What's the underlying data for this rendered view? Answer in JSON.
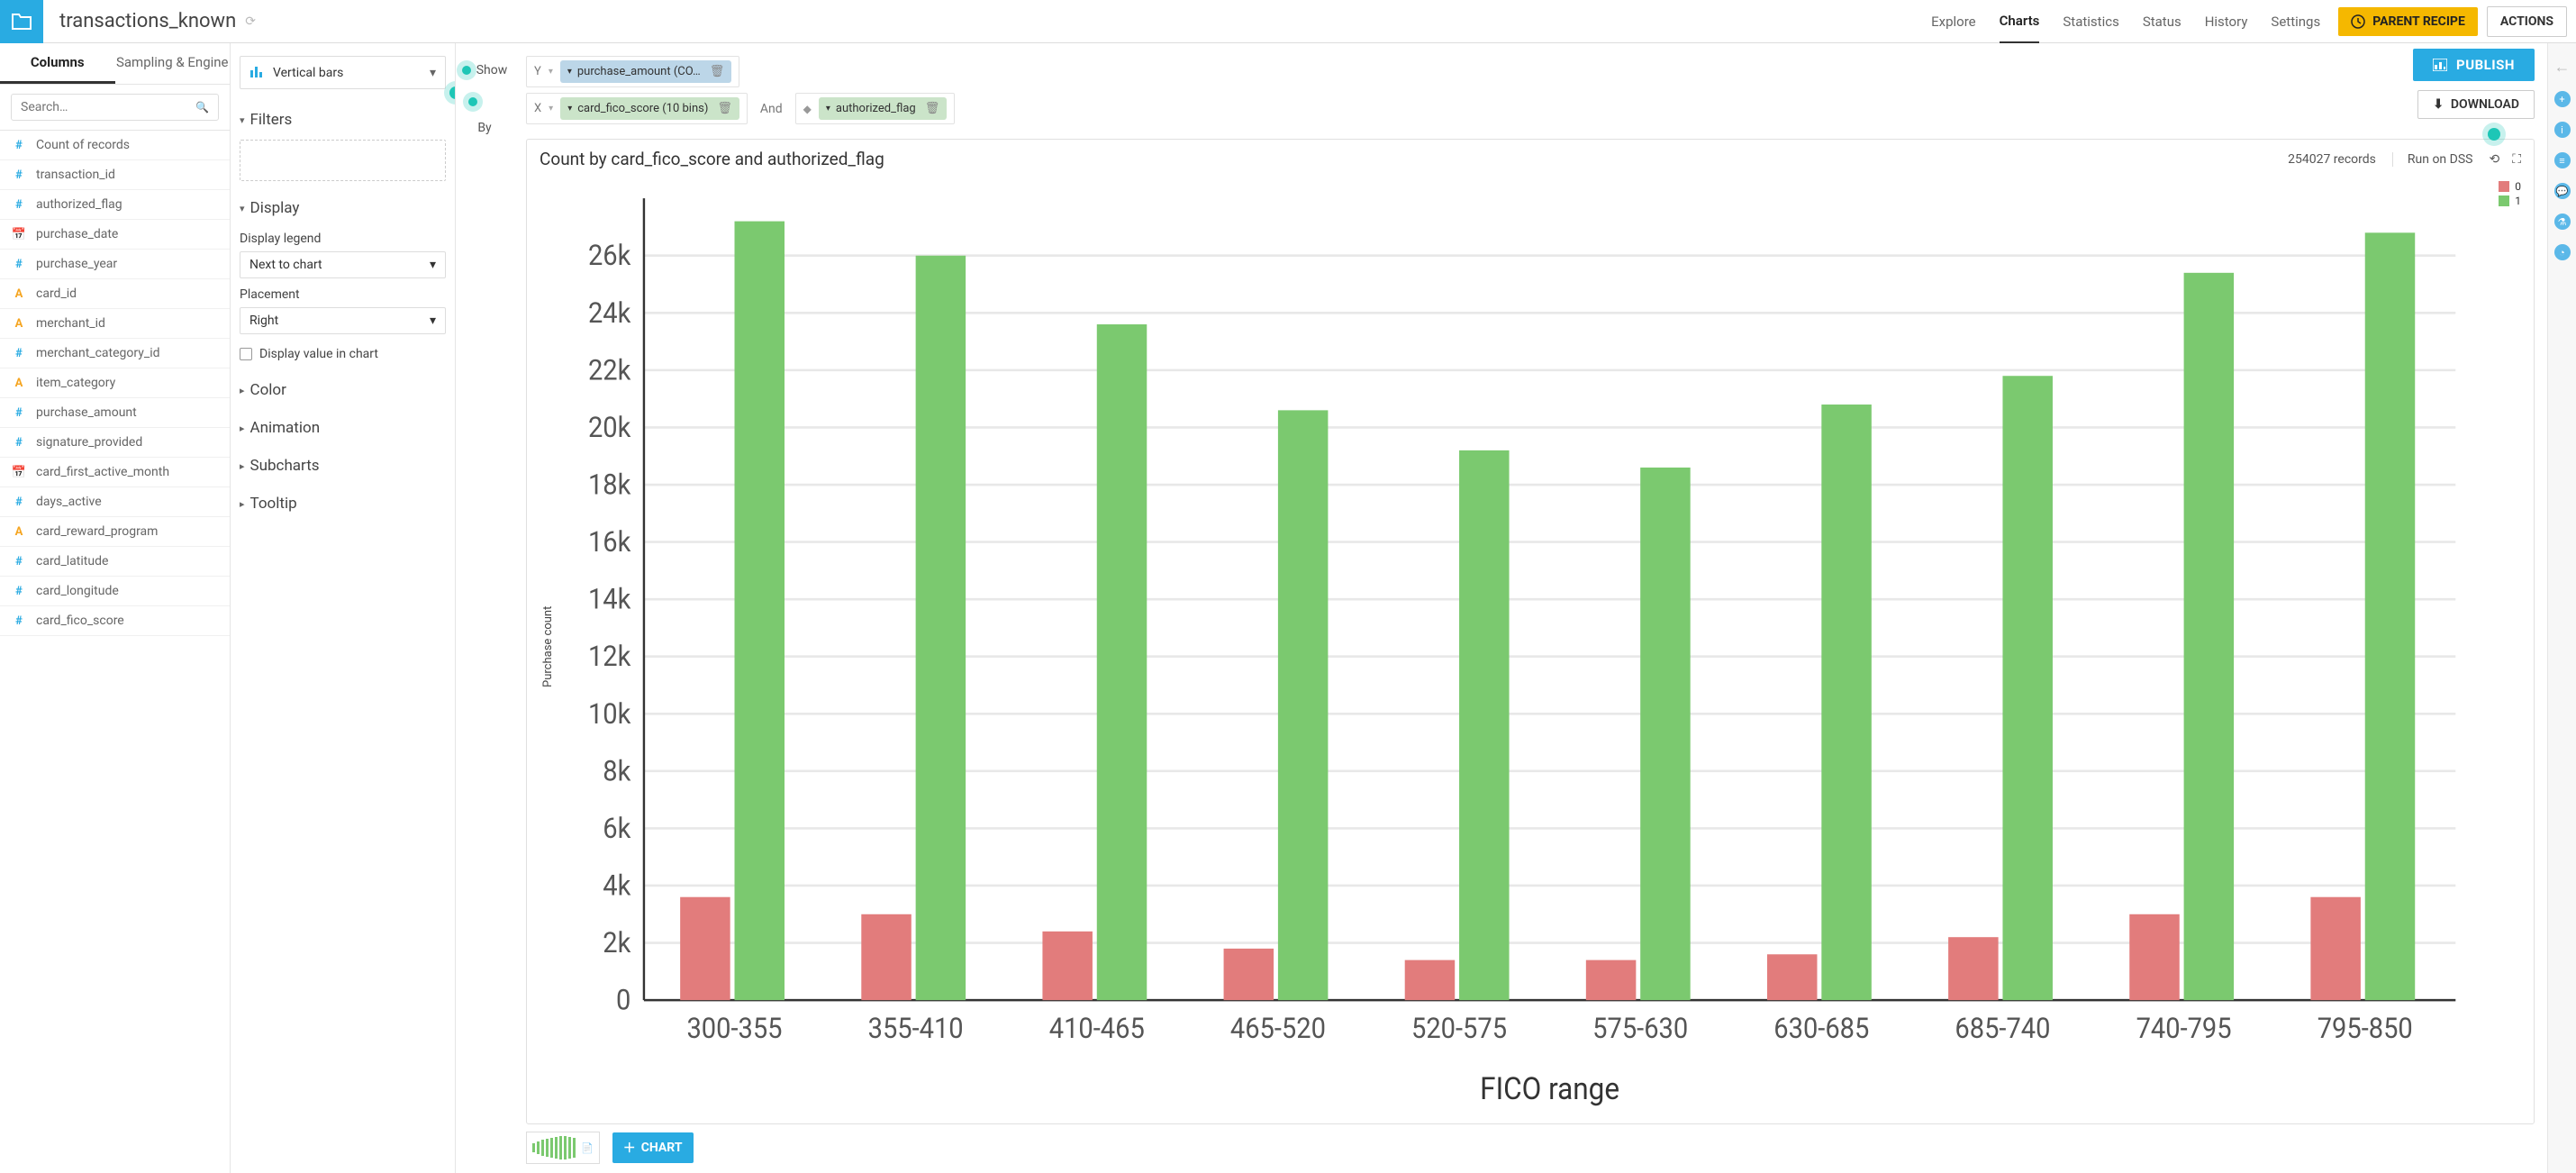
{
  "header": {
    "dataset_name": "transactions_known",
    "nav": [
      "Explore",
      "Charts",
      "Statistics",
      "Status",
      "History",
      "Settings"
    ],
    "nav_active": "Charts",
    "parent_recipe": "PARENT RECIPE",
    "actions": "ACTIONS"
  },
  "columns_panel": {
    "tabs": {
      "columns": "Columns",
      "sampling": "Sampling & Engine"
    },
    "search_placeholder": "Search…",
    "items": [
      {
        "type": "num",
        "label": "Count of records"
      },
      {
        "type": "num",
        "label": "transaction_id"
      },
      {
        "type": "num",
        "label": "authorized_flag"
      },
      {
        "type": "date",
        "label": "purchase_date"
      },
      {
        "type": "num",
        "label": "purchase_year"
      },
      {
        "type": "text",
        "label": "card_id"
      },
      {
        "type": "text",
        "label": "merchant_id"
      },
      {
        "type": "num",
        "label": "merchant_category_id"
      },
      {
        "type": "text",
        "label": "item_category"
      },
      {
        "type": "num",
        "label": "purchase_amount"
      },
      {
        "type": "num",
        "label": "signature_provided"
      },
      {
        "type": "date",
        "label": "card_first_active_month"
      },
      {
        "type": "num",
        "label": "days_active"
      },
      {
        "type": "text",
        "label": "card_reward_program"
      },
      {
        "type": "num",
        "label": "card_latitude"
      },
      {
        "type": "num",
        "label": "card_longitude"
      },
      {
        "type": "num",
        "label": "card_fico_score"
      }
    ]
  },
  "config": {
    "chart_type": "Vertical bars",
    "sections": {
      "filters": "Filters",
      "display": "Display",
      "color": "Color",
      "animation": "Animation",
      "subcharts": "Subcharts",
      "tooltip": "Tooltip"
    },
    "display_legend_label": "Display legend",
    "display_legend_value": "Next to chart",
    "placement_label": "Placement",
    "placement_value": "Right",
    "display_value_checkbox": "Display value in chart"
  },
  "showby": {
    "show": "Show",
    "by": "By"
  },
  "axes": {
    "y_label": "Y",
    "y_chip": "purchase_amount (CO…",
    "x_label": "X",
    "x_chip": "card_fico_score (10 bins)",
    "and_label": "And",
    "and_chip": "authorized_flag"
  },
  "buttons": {
    "publish": "PUBLISH",
    "download": "DOWNLOAD",
    "chart_add": "CHART"
  },
  "chart_meta": {
    "title": "Count by card_fico_score and authorized_flag",
    "records": "254027 records",
    "run_on": "Run on DSS"
  },
  "chart_data": {
    "type": "bar",
    "title": "Count by card_fico_score and authorized_flag",
    "xlabel": "FICO range",
    "ylabel": "Purchase count",
    "categories": [
      "300-355",
      "355-410",
      "410-465",
      "465-520",
      "520-575",
      "575-630",
      "630-685",
      "685-740",
      "740-795",
      "795-850"
    ],
    "series": [
      {
        "name": "0",
        "color": "#e27c7c",
        "values": [
          3600,
          3000,
          2400,
          1800,
          1400,
          1400,
          1600,
          2200,
          3000,
          3600
        ]
      },
      {
        "name": "1",
        "color": "#7bc96f",
        "values": [
          27200,
          26000,
          23600,
          20600,
          19200,
          18600,
          20800,
          21800,
          25400,
          26800
        ]
      }
    ],
    "y_ticks": [
      0,
      2000,
      4000,
      6000,
      8000,
      10000,
      12000,
      14000,
      16000,
      18000,
      20000,
      22000,
      24000,
      26000
    ],
    "y_tick_labels": [
      "0",
      "2k",
      "4k",
      "6k",
      "8k",
      "10k",
      "12k",
      "14k",
      "16k",
      "18k",
      "20k",
      "22k",
      "24k",
      "26k"
    ],
    "ylim": [
      0,
      28000
    ]
  }
}
